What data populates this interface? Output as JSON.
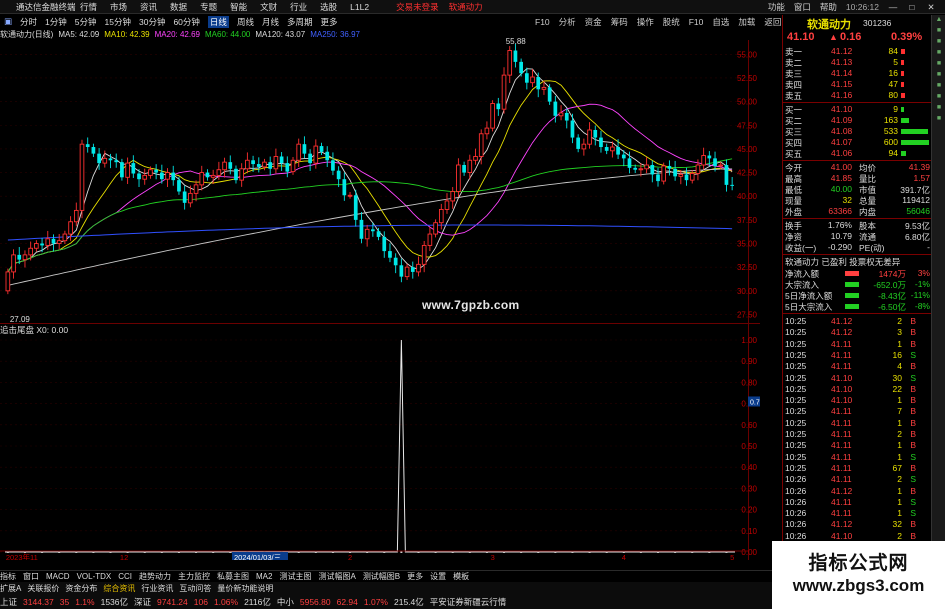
{
  "titlebar": {
    "app_title": "通达信金融终端",
    "menus": [
      "行情",
      "市场",
      "资讯",
      "数据",
      "专题",
      "智能",
      "文财",
      "行业",
      "选股",
      "L1L2"
    ],
    "alert": "交易未登录",
    "alert2": "软通动力",
    "right_items": [
      "功能",
      "窗口",
      "帮助"
    ],
    "time": "10:26:12",
    "window_buttons": [
      "—",
      "□",
      "✕"
    ]
  },
  "periods": [
    "分时",
    "1分钟",
    "5分钟",
    "15分钟",
    "30分钟",
    "60分钟",
    "日线",
    "周线",
    "月线",
    "多周期",
    "更多"
  ],
  "active_period": "日线",
  "toolbar_right": [
    "F10",
    "分析",
    "资金",
    "筹码",
    "操作",
    "股统",
    "F10",
    "自选",
    "加载",
    "返回"
  ],
  "ma_legend": [
    {
      "text": "软通动力(日线)",
      "color": "#dddddd"
    },
    {
      "text": "MA5: 42.09",
      "color": "#dddddd"
    },
    {
      "text": "MA10: 42.39",
      "color": "#e8e000"
    },
    {
      "text": "MA20: 42.69",
      "color": "#ff44ff"
    },
    {
      "text": "MA60: 44.00",
      "color": "#22d022"
    },
    {
      "text": "MA120: 43.07",
      "color": "#dddddd"
    },
    {
      "text": "MA250: 36.97",
      "color": "#4060ff"
    }
  ],
  "price_axis": {
    "labels": [
      "55.00",
      "52.50",
      "50.00",
      "47.50",
      "45.00",
      "42.50",
      "40.00",
      "37.50",
      "35.00",
      "32.50",
      "30.00",
      "27.50"
    ],
    "min": 26.6,
    "max": 56.3
  },
  "price_high_label": "55.88",
  "price_low_label": "27.09",
  "watermark": "www.7gpzb.com",
  "sub_legend": {
    "name": "追击尾盘",
    "value": "X0: 0.00"
  },
  "sub_axis": {
    "labels": [
      "1.00",
      "0.90",
      "0.80",
      "0.70",
      "0.60",
      "0.50",
      "0.40",
      "0.30",
      "0.20",
      "0.10",
      "0.00"
    ]
  },
  "sub_marker": "0.71",
  "date_axis": {
    "labels": [
      "2023年11",
      "12",
      "2024/01/03/三",
      "2",
      "3",
      "4",
      "5"
    ],
    "highlight": "2024/01/03/三"
  },
  "quote": {
    "name": "软通动力",
    "code": "301236",
    "price": "41.10",
    "change": "0.16",
    "pct": "0.39%",
    "asks": [
      {
        "label": "卖五",
        "price": "41.16",
        "vol": "80"
      },
      {
        "label": "卖四",
        "price": "41.15",
        "vol": "47"
      },
      {
        "label": "卖三",
        "price": "41.14",
        "vol": "16"
      },
      {
        "label": "卖二",
        "price": "41.13",
        "vol": "5"
      },
      {
        "label": "卖一",
        "price": "41.12",
        "vol": "84"
      }
    ],
    "bids": [
      {
        "label": "买一",
        "price": "41.10",
        "vol": "9"
      },
      {
        "label": "买二",
        "price": "41.09",
        "vol": "163"
      },
      {
        "label": "买三",
        "price": "41.08",
        "vol": "533"
      },
      {
        "label": "买四",
        "price": "41.07",
        "vol": "600"
      },
      {
        "label": "买五",
        "price": "41.06",
        "vol": "94"
      }
    ],
    "stats": [
      [
        {
          "t": "今开",
          "c": "#ddd"
        },
        {
          "t": "41.00",
          "c": "#ff4040"
        },
        {
          "t": "均价",
          "c": "#ddd"
        },
        {
          "t": "41.39",
          "c": "#ff4040"
        }
      ],
      [
        {
          "t": "最高",
          "c": "#ddd"
        },
        {
          "t": "41.85",
          "c": "#ff4040"
        },
        {
          "t": "量比",
          "c": "#ddd"
        },
        {
          "t": "1.57",
          "c": "#ff4040"
        }
      ],
      [
        {
          "t": "最低",
          "c": "#ddd"
        },
        {
          "t": "40.00",
          "c": "#22d022"
        },
        {
          "t": "市值",
          "c": "#ddd"
        },
        {
          "t": "391.7亿",
          "c": "#ddd"
        }
      ],
      [
        {
          "t": "现量",
          "c": "#ddd"
        },
        {
          "t": "32",
          "c": "#e8e000"
        },
        {
          "t": "总量",
          "c": "#ddd"
        },
        {
          "t": "119412",
          "c": "#ddd"
        }
      ],
      [
        {
          "t": "外盘",
          "c": "#ddd"
        },
        {
          "t": "63366",
          "c": "#ff4040"
        },
        {
          "t": "内盘",
          "c": "#ddd"
        },
        {
          "t": "56046",
          "c": "#22d022"
        }
      ],
      [
        {
          "t": "换手",
          "c": "#ddd"
        },
        {
          "t": "1.76%",
          "c": "#ddd"
        },
        {
          "t": "股本",
          "c": "#ddd"
        },
        {
          "t": "9.53亿",
          "c": "#ddd"
        }
      ],
      [
        {
          "t": "净资",
          "c": "#ddd"
        },
        {
          "t": "10.79",
          "c": "#ddd"
        },
        {
          "t": "流通",
          "c": "#ddd"
        },
        {
          "t": "6.80亿",
          "c": "#ddd"
        }
      ],
      [
        {
          "t": "收益(一)",
          "c": "#ddd"
        },
        {
          "t": "-0.290",
          "c": "#ddd"
        },
        {
          "t": "PE(动)",
          "c": "#ddd"
        },
        {
          "t": "-",
          "c": "#ddd"
        }
      ]
    ],
    "tags": "软通动力  已盈利  投票权无差异",
    "flow": [
      {
        "label": "净流入额",
        "value": "1474万",
        "pct": "3%",
        "c": "#ff4040"
      },
      {
        "label": "大宗流入",
        "value": "-652.0万",
        "pct": "-1%",
        "c": "#22d022"
      },
      {
        "label": "5日净流入额",
        "value": "-8.43亿",
        "pct": "-11%",
        "c": "#22d022"
      },
      {
        "label": "5日大宗流入",
        "value": "-6.50亿",
        "pct": "-8%",
        "c": "#22d022"
      }
    ],
    "ticks": [
      [
        "10:25",
        "41.12",
        "2",
        "B"
      ],
      [
        "10:25",
        "41.12",
        "3",
        "B"
      ],
      [
        "10:25",
        "41.11",
        "1",
        "B"
      ],
      [
        "10:25",
        "41.11",
        "16",
        "S"
      ],
      [
        "10:25",
        "41.11",
        "4",
        "B"
      ],
      [
        "10:25",
        "41.10",
        "30",
        "S"
      ],
      [
        "10:25",
        "41.10",
        "22",
        "B"
      ],
      [
        "10:25",
        "41.10",
        "1",
        "B"
      ],
      [
        "10:25",
        "41.11",
        "7",
        "B"
      ],
      [
        "10:25",
        "41.11",
        "1",
        "B"
      ],
      [
        "10:25",
        "41.11",
        "2",
        "B"
      ],
      [
        "10:25",
        "41.11",
        "1",
        "B"
      ],
      [
        "10:25",
        "41.11",
        "1",
        "S"
      ],
      [
        "10:25",
        "41.11",
        "67",
        "B"
      ],
      [
        "10:26",
        "41.11",
        "2",
        "S"
      ],
      [
        "10:26",
        "41.12",
        "1",
        "B"
      ],
      [
        "10:26",
        "41.11",
        "1",
        "S"
      ],
      [
        "10:26",
        "41.11",
        "1",
        "S"
      ],
      [
        "10:26",
        "41.12",
        "32",
        "B"
      ],
      [
        "10:26",
        "41.10",
        "2",
        "B"
      ]
    ]
  },
  "bottom_tabs": [
    "指标",
    "窗口",
    "MACD",
    "VOL-TDX",
    "CCI",
    "趋势动力",
    "主力监控",
    "私募主图",
    "MA2",
    "测试主图",
    "测试幅图A",
    "测试幅图B",
    "更多",
    "设置",
    "模板"
  ],
  "status": {
    "line1": [
      {
        "t": "扩展A",
        "c": "#ddd"
      },
      {
        "t": "关联报价",
        "c": "#ddd"
      },
      {
        "t": "资金分布",
        "c": "#ddd"
      },
      {
        "t": "综合资讯",
        "c": "#e8c000"
      },
      {
        "t": "行业资讯",
        "c": "#ddd"
      },
      {
        "t": "互动问答",
        "c": "#ddd"
      },
      {
        "t": "量价新功能说明",
        "c": "#ddd"
      }
    ],
    "line2": [
      {
        "t": "上证",
        "c": "#ddd"
      },
      {
        "t": "3144.37",
        "c": "#ff4040"
      },
      {
        "t": "35",
        "c": "#ff4040"
      },
      {
        "t": "1.1%",
        "c": "#ff4040"
      },
      {
        "t": "1536亿",
        "c": "#ddd"
      },
      {
        "t": "深证",
        "c": "#ddd"
      },
      {
        "t": "9741.24",
        "c": "#ff4040"
      },
      {
        "t": "106",
        "c": "#ff4040"
      },
      {
        "t": "1.06%",
        "c": "#ff4040"
      },
      {
        "t": "2116亿",
        "c": "#ddd"
      },
      {
        "t": "中小",
        "c": "#ddd"
      },
      {
        "t": "5956.80",
        "c": "#ff4040"
      },
      {
        "t": "62.94",
        "c": "#ff4040"
      },
      {
        "t": "1.07%",
        "c": "#ff4040"
      },
      {
        "t": "215.4亿",
        "c": "#ddd"
      },
      {
        "t": "平安证券新疆云行情",
        "c": "#ddd"
      }
    ]
  },
  "brand": {
    "line1": "指标公式网",
    "line2": "www.zbgs3.com"
  },
  "colors": {
    "up": "#ff3030",
    "down": "#00e8e8",
    "ma5": "#dddddd",
    "ma10": "#e8e000",
    "ma20": "#ff44ff",
    "ma60": "#22d022",
    "ma120": "#c8c8c8",
    "ma250": "#3050ff",
    "grid": "#6a0000"
  },
  "chart_data": {
    "type": "candlestick",
    "x": [
      "2023年11",
      "12",
      "2024/01/03/三",
      "2",
      "3",
      "4",
      "5"
    ],
    "open": [
      30,
      32,
      33.8,
      33.3,
      33.8,
      34.5,
      35,
      34.8,
      35.5,
      35,
      35.3,
      36,
      37.3,
      38.5,
      45.5,
      45.2,
      44.5,
      43.5,
      44,
      43.8,
      43.6,
      42,
      43.5,
      42.4,
      41.8,
      42.2,
      42.8,
      42.5,
      41.8,
      42.5,
      41.7,
      40.5,
      39.3,
      40.3,
      41.2,
      42.5,
      42,
      42.2,
      42.8,
      43.6,
      42.9,
      41.7,
      42.9,
      43.8,
      43.4,
      43.1,
      43.6,
      42.9,
      44.2,
      43.5,
      42.6,
      43.8,
      45.5,
      44.5,
      43.5,
      45.3,
      44.7,
      43.8,
      42.7,
      41.8,
      40.1,
      40.1,
      37.5,
      35.5,
      36.5,
      36.3,
      35.7,
      34.2,
      33.5,
      32.7,
      31.5,
      32.5,
      32,
      32.8,
      34.8,
      36,
      37.2,
      38.6,
      39.5,
      40.5,
      43.3,
      42.5,
      43.8,
      44.2,
      46.6,
      47.2,
      49.8,
      49.2,
      52.8,
      55.4,
      54.2,
      53,
      52,
      52.6,
      51.3,
      51.5,
      50,
      48.5,
      48.8,
      48,
      46.2,
      45,
      45.5,
      47,
      46.2,
      45.2,
      44.8,
      45.2,
      44.4,
      44,
      43,
      42.8,
      42.9,
      43.3,
      42.3,
      41.6,
      43.2,
      42.9,
      42.1,
      42.3,
      41.7,
      42.4,
      43.3,
      44.3,
      44,
      43.2,
      43.3,
      41.2
    ],
    "close": [
      32,
      33.8,
      33.3,
      33.8,
      34.5,
      35,
      34.8,
      35.5,
      35,
      35.3,
      36,
      37.3,
      38.5,
      45.5,
      45.2,
      44.5,
      43.5,
      44,
      43.8,
      43.6,
      42,
      43.5,
      42.4,
      41.8,
      42.2,
      42.8,
      42.5,
      41.8,
      42.5,
      41.7,
      40.5,
      39.3,
      40.3,
      41.2,
      42.5,
      42,
      42.2,
      42.8,
      43.6,
      42.9,
      41.7,
      42.9,
      43.8,
      43.4,
      43.1,
      43.6,
      42.9,
      44.2,
      43.5,
      42.6,
      43.8,
      45.5,
      44.5,
      43.5,
      45.3,
      44.7,
      43.8,
      42.7,
      41.8,
      40.1,
      40.1,
      37.5,
      35.5,
      36.5,
      36.3,
      35.7,
      34.2,
      33.5,
      32.7,
      31.5,
      32.5,
      32,
      32.8,
      34.8,
      36,
      37.2,
      38.6,
      39.5,
      40.5,
      43.3,
      42.5,
      43.8,
      44.2,
      46.6,
      47.2,
      49.8,
      49.2,
      52.8,
      55.4,
      54.2,
      53,
      52,
      52.6,
      51.3,
      51.5,
      50,
      48.5,
      48.8,
      48,
      46.2,
      45,
      45.5,
      47,
      46.2,
      45.2,
      44.8,
      45.2,
      44.4,
      44,
      43,
      42.8,
      42.9,
      43.3,
      42.3,
      41.6,
      43.2,
      42.9,
      42.1,
      42.3,
      41.7,
      42.4,
      43.3,
      44.3,
      44,
      43.2,
      43.3,
      41.2,
      41.1
    ],
    "high_label": "55.88",
    "low_label": "27.09",
    "ma": {
      "MA5": 42.09,
      "MA10": 42.39,
      "MA20": 42.69,
      "MA60": 44.0,
      "MA120": 43.07,
      "MA250": 36.97
    },
    "ylim": [
      26.6,
      56.3
    ],
    "sub_indicator": {
      "name": "追击尾盘",
      "values": "0 everywhere, a single spike to 1.00",
      "spike_index": 69,
      "ylim": [
        0,
        1
      ]
    }
  }
}
